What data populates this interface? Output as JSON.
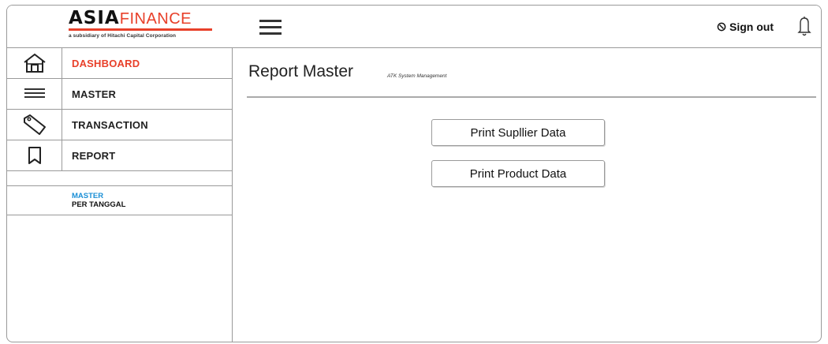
{
  "brand": {
    "name_bold": "ASIA",
    "name_light": "FINANCE",
    "tagline": "a subsidiary of Hitachi Capital Corporation"
  },
  "header": {
    "signout_label": "Sign out"
  },
  "sidebar": {
    "items": [
      {
        "label": "DASHBOARD",
        "icon": "home-icon",
        "active": true
      },
      {
        "label": "MASTER",
        "icon": "list-icon",
        "active": false
      },
      {
        "label": "TRANSACTION",
        "icon": "tag-icon",
        "active": false
      },
      {
        "label": "REPORT",
        "icon": "bookmark-icon",
        "active": false
      }
    ],
    "sub_item": {
      "line1": "MASTER",
      "line2": "PER TANGGAL"
    }
  },
  "main": {
    "title": "Report Master",
    "subtitle": "ATK System Management",
    "buttons": [
      {
        "label": "Print Supllier Data"
      },
      {
        "label": "Print Product Data"
      }
    ]
  },
  "colors": {
    "accent": "#e8402a",
    "link_blue": "#1a8fd6",
    "border": "#9a9a9a"
  }
}
